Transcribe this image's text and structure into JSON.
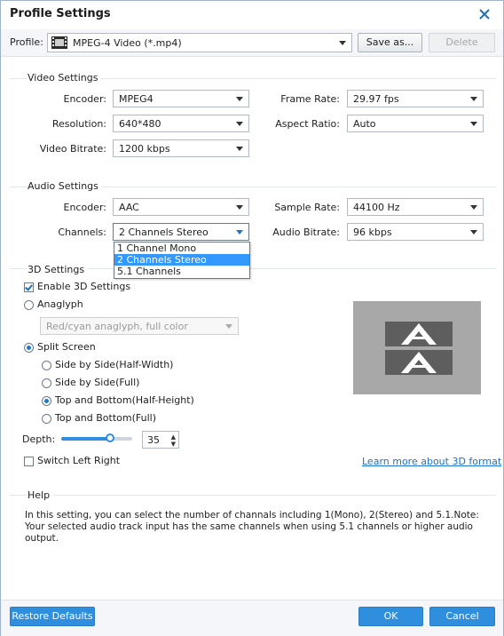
{
  "window": {
    "title": "Profile Settings",
    "close_icon": "close-icon"
  },
  "profile": {
    "label": "Profile:",
    "value": "MPEG-4 Video (*.mp4)",
    "save_as": "Save as...",
    "delete": "Delete"
  },
  "video": {
    "section": "Video Settings",
    "encoder_label": "Encoder:",
    "encoder": "MPEG4",
    "frame_rate_label": "Frame Rate:",
    "frame_rate": "29.97 fps",
    "resolution_label": "Resolution:",
    "resolution": "640*480",
    "aspect_ratio_label": "Aspect Ratio:",
    "aspect_ratio": "Auto",
    "bitrate_label": "Video Bitrate:",
    "bitrate": "1200 kbps"
  },
  "audio": {
    "section": "Audio Settings",
    "encoder_label": "Encoder:",
    "encoder": "AAC",
    "sample_rate_label": "Sample Rate:",
    "sample_rate": "44100 Hz",
    "channels_label": "Channels:",
    "channels": "2 Channels Stereo",
    "bitrate_label": "Audio Bitrate:",
    "bitrate": "96 kbps",
    "channel_options": [
      "1 Channel Mono",
      "2 Channels Stereo",
      "5.1 Channels"
    ],
    "selected_option": "2 Channels Stereo"
  },
  "three_d": {
    "section": "3D Settings",
    "enable": "Enable 3D Settings",
    "enable_checked": true,
    "anaglyph": "Anaglyph",
    "anaglyph_mode": "Red/cyan anaglyph, full color",
    "split_screen": "Split Screen",
    "side_half": "Side by Side(Half-Width)",
    "side_full": "Side by Side(Full)",
    "top_half": "Top and Bottom(Half-Height)",
    "top_full": "Top and Bottom(Full)",
    "selected_split": "Top and Bottom(Half-Height)",
    "depth_label": "Depth:",
    "depth": "35",
    "switch": "Switch Left Right",
    "switch_checked": false,
    "learn_more": "Learn more about 3D format",
    "preview_letter": "A"
  },
  "help": {
    "section": "Help",
    "text": "In this setting, you can select the number of channals including 1(Mono), 2(Stereo) and 5.1.Note: Your selected audio track input has the same channels when using 5.1 channels or higher audio output."
  },
  "footer": {
    "restore": "Restore Defaults",
    "ok": "OK",
    "cancel": "Cancel"
  },
  "colors": {
    "accent": "#2f8fde",
    "selection": "#3399ff",
    "link": "#1a73c8",
    "preview_bg": "#a8a8a8"
  }
}
